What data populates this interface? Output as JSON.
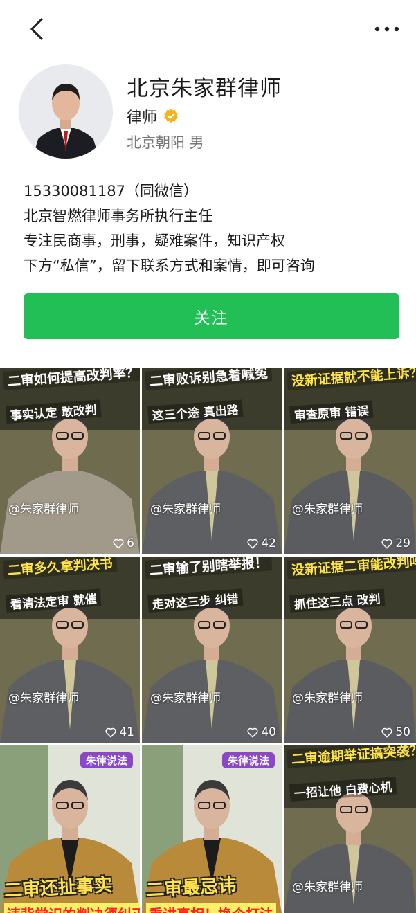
{
  "profile": {
    "name": "北京朱家群律师",
    "title": "律师",
    "location": "北京朝阳 男"
  },
  "bio": {
    "line1": "15330081187（同微信）",
    "line2": "北京智燃律师事务所执行主任",
    "line3": "专注民商事，刑事，疑难案件，知识产权",
    "line4": "下方“私信”，留下联系方式和案情，即可咨询"
  },
  "actions": {
    "follow_label": "关注"
  },
  "colors": {
    "accent": "#21bf55",
    "verified": "#f5b21c",
    "tag": "#8a48c7"
  },
  "icons": {
    "back": "chevron-left-icon",
    "more": "more-horizontal-icon",
    "verified": "verified-badge-icon",
    "like": "heart-outline-icon"
  },
  "videos": [
    {
      "hook": "二审如何提高改判率？",
      "sub": "事实认定 敢改判",
      "watermark": "@朱家群律师",
      "likes": "6"
    },
    {
      "hook": "二审败诉别急着喊冤",
      "sub": "这三个途 真出路",
      "watermark": "@朱家群律师",
      "likes": "42"
    },
    {
      "hook": "没新证据就不能上诉？",
      "sub": "审查原审 错误",
      "watermark": "@朱家群律师",
      "likes": "29"
    },
    {
      "hook": "二审多久拿判决书",
      "sub": "看清法定审 就催",
      "watermark": "@朱家群律师",
      "likes": "41"
    },
    {
      "hook": "二审输了别瞎举报！",
      "sub": "走对这三步 纠错",
      "watermark": "@朱家群律师",
      "likes": "40"
    },
    {
      "hook": "没新证据二审能改判吗",
      "sub": "抓住这三点 改判",
      "watermark": "@朱家群律师",
      "likes": "50"
    },
    {
      "tag": "朱律说法",
      "caption": "二审还扯事实",
      "bottom": "违背常识的判决须纠正"
    },
    {
      "tag": "朱律说法",
      "caption": "二审最忌讳",
      "bottom": "重讲真相！换个打法"
    },
    {
      "hook": "二审逾期举证搞突袭？",
      "sub": "一招让他 白费心机",
      "watermark": "@朱家群律师"
    }
  ]
}
